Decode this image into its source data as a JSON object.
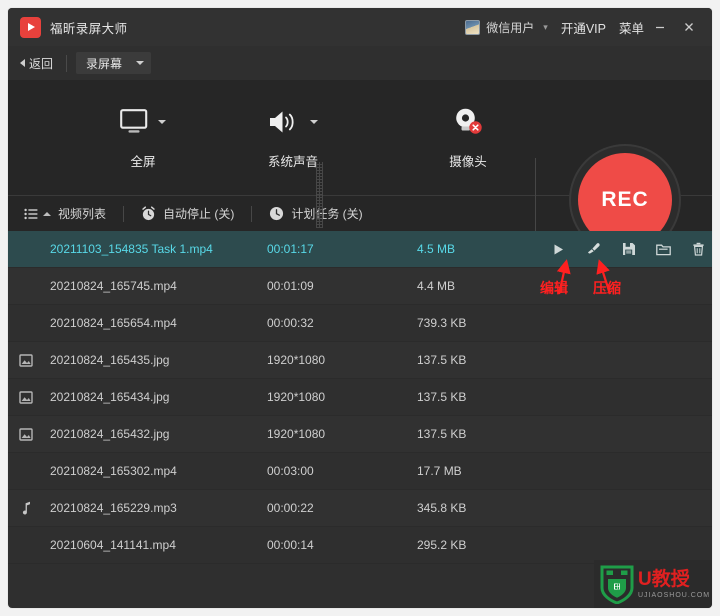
{
  "window": {
    "title": "福昕录屏大师",
    "logo_icon": "video-play-logo-icon",
    "minimize_label": "—",
    "close_label": "✕"
  },
  "titlebar_right": {
    "avatar_icon": "user-avatar-icon",
    "user_name": "微信用户",
    "caret_icon": "chevron-down-icon",
    "vip_label": "开通VIP",
    "menu_label": "菜单"
  },
  "subbar": {
    "back_label": "返回",
    "back_icon": "back-arrow-icon",
    "mode_label": "录屏幕",
    "mode_caret_icon": "chevron-down-icon"
  },
  "capture": {
    "items": [
      {
        "label": "全屏",
        "icon": "monitor-icon",
        "has_caret": true
      },
      {
        "label": "系统声音",
        "icon": "speaker-icon",
        "has_caret": true
      },
      {
        "label": "摄像头",
        "icon": "webcam-disabled-icon",
        "has_caret": false
      }
    ],
    "record_button_label": "REC"
  },
  "list_toolbar": {
    "list_icon": "list-view-icon",
    "list_label": "视频列表",
    "autostop_icon": "alarm-clock-icon",
    "autostop_label": "自动停止 (关)",
    "schedule_icon": "clock-icon",
    "schedule_label": "计划任务 (关)"
  },
  "file_list": {
    "rows": [
      {
        "icon": "",
        "name": "20211103_154835 Task 1.mp4",
        "duration": "00:01:17",
        "size": "4.5 MB",
        "selected": true
      },
      {
        "icon": "",
        "name": "20210824_165745.mp4",
        "duration": "00:01:09",
        "size": "4.4 MB",
        "selected": false
      },
      {
        "icon": "",
        "name": "20210824_165654.mp4",
        "duration": "00:00:32",
        "size": "739.3 KB",
        "selected": false
      },
      {
        "icon": "image-icon",
        "name": "20210824_165435.jpg",
        "duration": "1920*1080",
        "size": "137.5 KB",
        "selected": false
      },
      {
        "icon": "image-icon",
        "name": "20210824_165434.jpg",
        "duration": "1920*1080",
        "size": "137.5 KB",
        "selected": false
      },
      {
        "icon": "image-icon",
        "name": "20210824_165432.jpg",
        "duration": "1920*1080",
        "size": "137.5 KB",
        "selected": false
      },
      {
        "icon": "",
        "name": "20210824_165302.mp4",
        "duration": "00:03:00",
        "size": "17.7 MB",
        "selected": false
      },
      {
        "icon": "music-note-icon",
        "name": "20210824_165229.mp3",
        "duration": "00:00:22",
        "size": "345.8 KB",
        "selected": false
      },
      {
        "icon": "",
        "name": "20210604_141141.mp4",
        "duration": "00:00:14",
        "size": "295.2 KB",
        "selected": false
      }
    ],
    "row_actions": [
      {
        "name": "play-icon"
      },
      {
        "name": "edit-brush-icon"
      },
      {
        "name": "compress-save-icon"
      },
      {
        "name": "folder-icon"
      },
      {
        "name": "trash-icon"
      }
    ]
  },
  "annotations": [
    {
      "label": "编辑",
      "arrow_to": "edit-brush-icon"
    },
    {
      "label": "压缩",
      "arrow_to": "compress-save-icon"
    }
  ],
  "watermark": {
    "brand": "U教授",
    "domain": "UJIAOSHOU.COM",
    "shield_icon": "usb-shield-logo-icon"
  },
  "colors": {
    "accent_red": "#ef4b47",
    "selected_row_bg": "#2d4b4e",
    "selected_row_text": "#58d9e8",
    "panel_bg": "#262626",
    "window_bg": "#2f2f2f",
    "annotation_red": "#ff2020"
  }
}
